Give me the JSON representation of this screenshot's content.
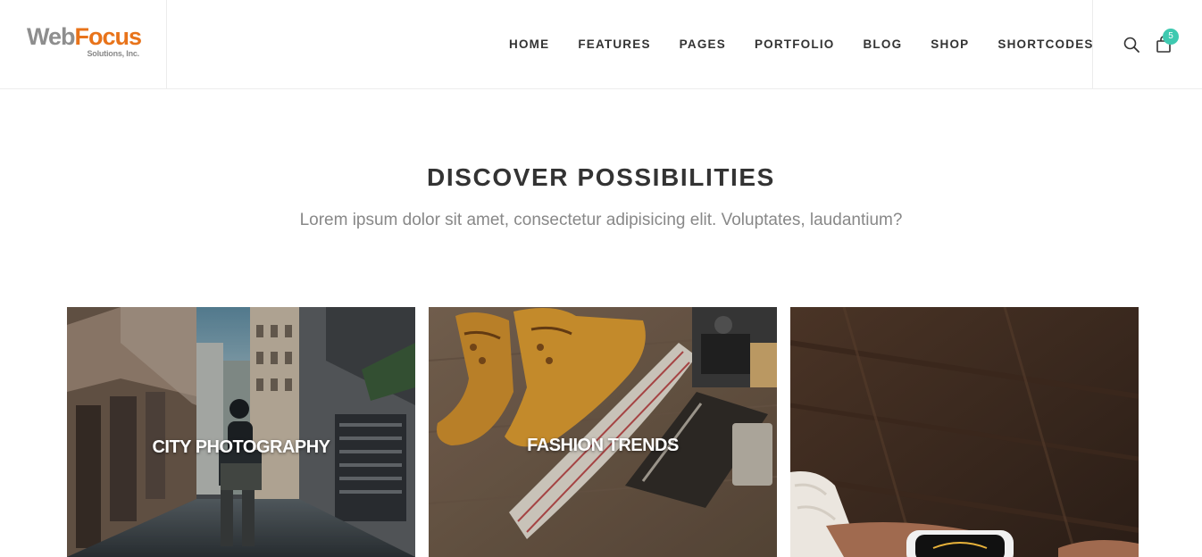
{
  "logo": {
    "word1": "Web",
    "word2": "Focus",
    "tagline": "Solutions, Inc."
  },
  "nav": {
    "items": [
      {
        "label": "HOME"
      },
      {
        "label": "FEATURES"
      },
      {
        "label": "PAGES"
      },
      {
        "label": "PORTFOLIO"
      },
      {
        "label": "BLOG"
      },
      {
        "label": "SHOP"
      },
      {
        "label": "SHORTCODES"
      }
    ]
  },
  "tools": {
    "search_icon": "search-icon",
    "cart_icon": "shopping-bag-icon",
    "cart_count": "5"
  },
  "intro": {
    "title": "DISCOVER POSSIBILITIES",
    "subtitle": "Lorem ipsum dolor sit amet, consectetur adipisicing elit. Voluptates, laudantium?"
  },
  "cards": [
    {
      "title": "CITY PHOTOGRAPHY"
    },
    {
      "title": "FASHION TRENDS"
    },
    {
      "title": ""
    }
  ],
  "colors": {
    "accent": "#3ec9b0",
    "logo_orange": "#e8731a",
    "logo_gray": "#8e8e8e",
    "text_dark": "#333333",
    "text_muted": "#888888"
  }
}
